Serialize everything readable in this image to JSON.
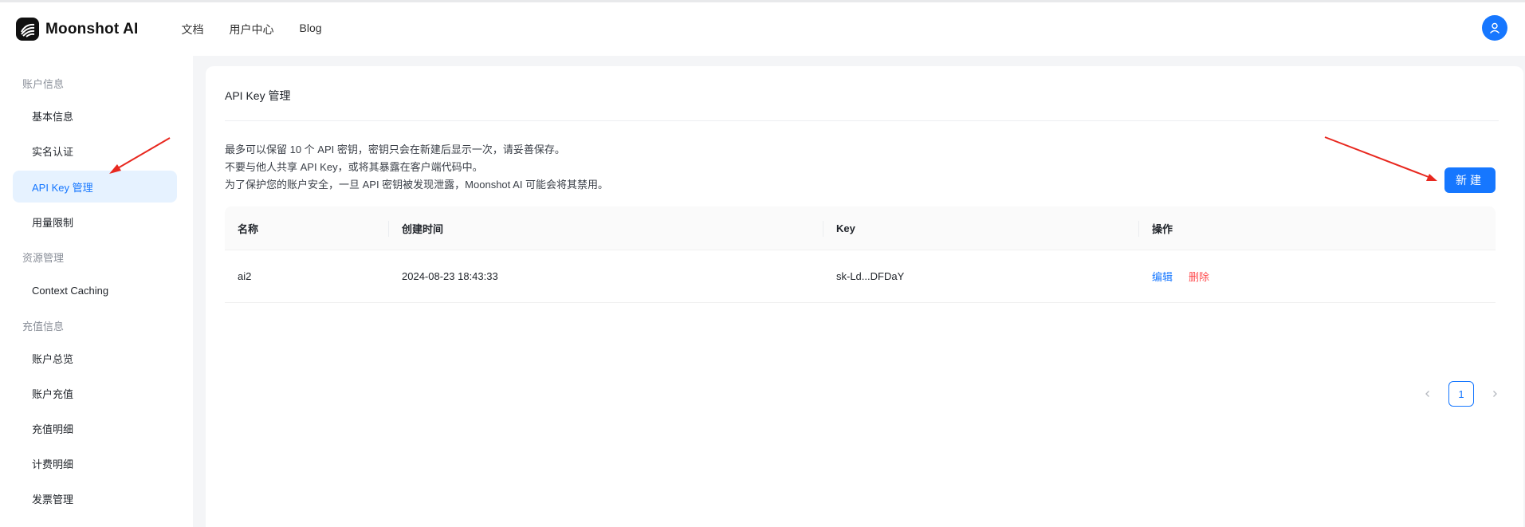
{
  "header": {
    "brand": "Moonshot AI",
    "nav": [
      "文档",
      "用户中心",
      "Blog"
    ]
  },
  "sidebar": {
    "groups": [
      {
        "title": "账户信息",
        "items": [
          "基本信息",
          "实名认证",
          "API Key 管理",
          "用量限制"
        ]
      },
      {
        "title": "资源管理",
        "items": [
          "Context Caching"
        ]
      },
      {
        "title": "充值信息",
        "items": [
          "账户总览",
          "账户充值",
          "充值明细",
          "计费明细",
          "发票管理"
        ]
      }
    ],
    "active": "API Key 管理"
  },
  "main": {
    "title": "API Key 管理",
    "info": [
      "最多可以保留 10 个 API 密钥，密钥只会在新建后显示一次，请妥善保存。",
      "不要与他人共享 API Key，或将其暴露在客户端代码中。",
      "为了保护您的账户安全，一旦 API 密钥被发现泄露，Moonshot AI 可能会将其禁用。"
    ],
    "new_button": "新建",
    "table": {
      "columns": [
        "名称",
        "创建时间",
        "Key",
        "操作"
      ],
      "rows": [
        {
          "name": "ai2",
          "created": "2024-08-23 18:43:33",
          "key": "sk-Ld...DFDaY",
          "edit": "编辑",
          "delete": "删除"
        }
      ]
    },
    "pagination": {
      "current": "1"
    }
  },
  "colors": {
    "primary": "#1677ff",
    "danger": "#ff4d4f",
    "annotation": "#e8281f"
  }
}
